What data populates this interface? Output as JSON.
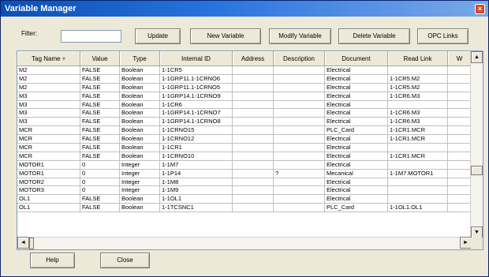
{
  "window": {
    "title": "Variable Manager",
    "close_glyph": "×"
  },
  "filter": {
    "label": "Filter:",
    "value": ""
  },
  "toolbar": {
    "update_label": "Update",
    "new_variable_label": "New Variable",
    "modify_variable_label": "Modify Variable",
    "delete_variable_label": "Delete Variable",
    "opc_links_label": "OPC Links"
  },
  "table": {
    "columns": [
      "Tag Name",
      "Value",
      "Type",
      "Internal ID",
      "Address",
      "Description",
      "Document",
      "Read Link",
      "W"
    ],
    "rows": [
      [
        "M2",
        "FALSE",
        "Boolean",
        "1-1CR5",
        "",
        "",
        "Electrical",
        "",
        ""
      ],
      [
        "M2",
        "FALSE",
        "Boolean",
        "1-1GRP11.1-1CRNO6",
        "",
        "",
        "Electrical",
        "1-1CR5.M2",
        ""
      ],
      [
        "M2",
        "FALSE",
        "Boolean",
        "1-1GRP11.1-1CRNO5",
        "",
        "",
        "Electrical",
        "1-1CR5.M2",
        ""
      ],
      [
        "M3",
        "FALSE",
        "Boolean",
        "1-1GRP14.1-1CRNO9",
        "",
        "",
        "Electrical",
        "1-1CR6.M3",
        ""
      ],
      [
        "M3",
        "FALSE",
        "Boolean",
        "1-1CR6",
        "",
        "",
        "Electrical",
        "",
        ""
      ],
      [
        "M3",
        "FALSE",
        "Boolean",
        "1-1GRP14.1-1CRNO7",
        "",
        "",
        "Electrical",
        "1-1CR6.M3",
        ""
      ],
      [
        "M3",
        "FALSE",
        "Boolean",
        "1-1GRP14.1-1CRNO8",
        "",
        "",
        "Electrical",
        "1-1CR6.M3",
        ""
      ],
      [
        "MCR",
        "FALSE",
        "Boolean",
        "1-1CRNO15",
        "",
        "",
        "PLC_Card",
        "1-1CR1.MCR",
        ""
      ],
      [
        "MCR",
        "FALSE",
        "Boolean",
        "1-1CRNO12",
        "",
        "",
        "Electrical",
        "1-1CR1.MCR",
        ""
      ],
      [
        "MCR",
        "FALSE",
        "Boolean",
        "1-1CR1",
        "",
        "",
        "Electrical",
        "",
        ""
      ],
      [
        "MCR",
        "FALSE",
        "Boolean",
        "1-1CRNO10",
        "",
        "",
        "Electrical",
        "1-1CR1.MCR",
        ""
      ],
      [
        "MOTOR1",
        "0",
        "Integer",
        "1-1M7",
        "",
        "",
        "Electrical",
        "",
        ""
      ],
      [
        "MOTOR1",
        "0",
        "Integer",
        "1-1P14",
        "",
        "?",
        "Mecanical",
        "1-1M7.MOTOR1",
        ""
      ],
      [
        "MOTOR2",
        "0",
        "Integer",
        "1-1M8",
        "",
        "",
        "Electrical",
        "",
        ""
      ],
      [
        "MOTOR3",
        "0",
        "Integer",
        "1-1M9",
        "",
        "",
        "Electrical",
        "",
        ""
      ],
      [
        "OL1",
        "FALSE",
        "Boolean",
        "1-1OL1",
        "",
        "",
        "Electrical",
        "",
        ""
      ],
      [
        "OL1",
        "FALSE",
        "Boolean",
        "1-1TCSNC1",
        "",
        "",
        "PLC_Card",
        "1-1OL1.OL1",
        ""
      ]
    ]
  },
  "footer": {
    "help_label": "Help",
    "close_label": "Close"
  },
  "icons": {
    "scroll_up": "▲",
    "scroll_down": "▼",
    "scroll_left": "◄",
    "scroll_right": "►",
    "sort": "▾"
  }
}
